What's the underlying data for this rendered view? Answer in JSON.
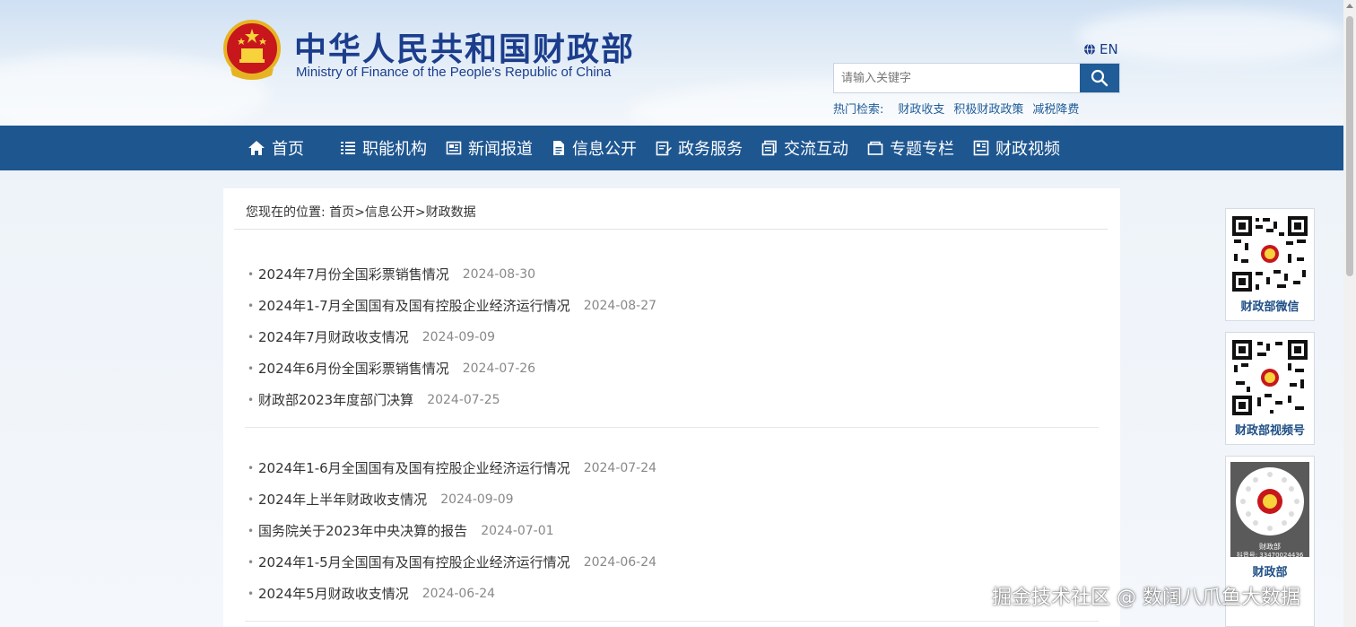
{
  "header": {
    "title": "中华人民共和国财政部",
    "subtitle": "Ministry of Finance of the People's Republic of China",
    "lang_label": "EN",
    "search_placeholder": "请输入关键字",
    "hotwords_label": "热门检索:",
    "hotwords": [
      "财政收支",
      "积极财政政策",
      "减税降费"
    ]
  },
  "nav": {
    "items": [
      {
        "label": "首页",
        "icon": "home-icon"
      },
      {
        "label": "职能机构",
        "icon": "list-icon"
      },
      {
        "label": "新闻报道",
        "icon": "newspaper-icon"
      },
      {
        "label": "信息公开",
        "icon": "document-icon"
      },
      {
        "label": "政务服务",
        "icon": "edit-icon"
      },
      {
        "label": "交流互动",
        "icon": "chat-icon"
      },
      {
        "label": "专题专栏",
        "icon": "folder-icon"
      },
      {
        "label": "财政视频",
        "icon": "video-icon"
      }
    ]
  },
  "breadcrumb": {
    "prefix": "您现在的位置:",
    "items": [
      "首页",
      "信息公开",
      "财政数据"
    ],
    "separator": ">"
  },
  "articles_group1": [
    {
      "title": "2024年7月份全国彩票销售情况",
      "date": "2024-08-30"
    },
    {
      "title": "2024年1-7月全国国有及国有控股企业经济运行情况",
      "date": "2024-08-27"
    },
    {
      "title": "2024年7月财政收支情况",
      "date": "2024-09-09"
    },
    {
      "title": "2024年6月份全国彩票销售情况",
      "date": "2024-07-26"
    },
    {
      "title": "财政部2023年度部门决算",
      "date": "2024-07-25"
    }
  ],
  "articles_group2": [
    {
      "title": "2024年1-6月全国国有及国有控股企业经济运行情况",
      "date": "2024-07-24"
    },
    {
      "title": "2024年上半年财政收支情况",
      "date": "2024-09-09"
    },
    {
      "title": "国务院关于2023年中央决算的报告",
      "date": "2024-07-01"
    },
    {
      "title": "2024年1-5月全国国有及国有控股企业经济运行情况",
      "date": "2024-06-24"
    },
    {
      "title": "2024年5月财政收支情况",
      "date": "2024-06-24"
    }
  ],
  "sidebar": {
    "qr_wechat": "财政部微信",
    "qr_video": "财政部视频号",
    "qr_douyin_caption": "财政部",
    "qr_douyin_id": "抖音号: 33470024436",
    "qr_douyin_label": "财政部"
  },
  "watermark": "掘金技术社区 @ 数阔八爪鱼大数据",
  "colors": {
    "nav_bg": "#1e5690",
    "title_blue": "#1b3d8c",
    "search_btn": "#1f5c98"
  }
}
